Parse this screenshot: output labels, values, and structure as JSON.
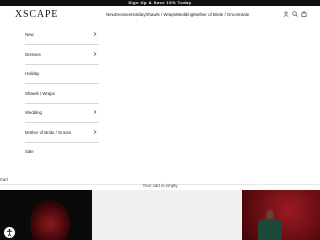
{
  "promo": {
    "text": "Sign Up & Save 15% Today"
  },
  "header": {
    "logo": "XSCAPE",
    "nav": [
      "New",
      "Dresses",
      "Holiday",
      "Shawls / Wraps",
      "Wedding",
      "Mother of Bride / Groom",
      "Sale"
    ],
    "icons": [
      "account-icon",
      "search-icon",
      "cart-bag-icon"
    ]
  },
  "menu": {
    "items": [
      {
        "label": "New",
        "has_submenu": true
      },
      {
        "label": "Dresses",
        "has_submenu": true
      },
      {
        "label": "Holiday",
        "has_submenu": false
      },
      {
        "label": "Shawls / Wraps",
        "has_submenu": false
      },
      {
        "label": "Wedding",
        "has_submenu": true
      },
      {
        "label": "Mother of Bride / Groom",
        "has_submenu": true
      },
      {
        "label": "Sale",
        "has_submenu": false
      }
    ]
  },
  "cart": {
    "label": "Cart",
    "empty_message": "Your cart is empty"
  },
  "colors": {
    "promo_bg": "#111111",
    "hero_red": "#6e0b12",
    "dress_green": "#1c4a3a"
  }
}
